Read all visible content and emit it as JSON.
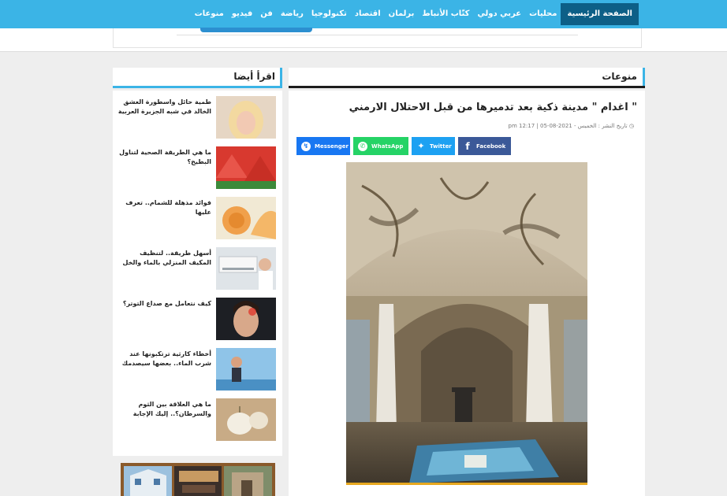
{
  "nav": {
    "items": [
      {
        "label": "الصفحة الرئيسية",
        "active": true
      },
      {
        "label": "محليات",
        "active": false
      },
      {
        "label": "عربي دولي",
        "active": false
      },
      {
        "label": "كتّاب الأنباط",
        "active": false
      },
      {
        "label": "برلمان",
        "active": false
      },
      {
        "label": "اقتصاد",
        "active": false
      },
      {
        "label": "تكنولوجيا",
        "active": false
      },
      {
        "label": "رياضة",
        "active": false
      },
      {
        "label": "فن",
        "active": false
      },
      {
        "label": "فيديو",
        "active": false
      },
      {
        "label": "منوعات",
        "active": false
      }
    ]
  },
  "main": {
    "section_title": "منوعات",
    "article_title": "\" اغدام \" مدينة ذكية بعد تدميرها من قبل الاحتلال الارمني",
    "meta": "تاريخ النشر : الخميس - 2021-08-05 | 12:17 pm",
    "share": {
      "messenger": "Messenger",
      "whatsapp": "WhatsApp",
      "twitter": "Twitter",
      "facebook": "Facebook"
    }
  },
  "sidebar": {
    "title": "اقرأ أيضا",
    "items": [
      {
        "text": "طمية حائل واسطورة العشق الخالد في شبه الجزيرة العربية"
      },
      {
        "text": "ما هي الطريقة الصحية لتناول البطيخ؟"
      },
      {
        "text": "فوائد مذهلة للشمام.. تعرف عليها"
      },
      {
        "text": "أسهل طريقة.. لتنظيف المكيف المنزلي بالماء والخل"
      },
      {
        "text": "كيف نتعامل مع صداع التوتر؟"
      },
      {
        "text": "أخطاء كارثية ترتكبونها عند شرب الماء.. بعضها سيصدمك"
      },
      {
        "text": "ما هي العلاقة بين الثوم والسرطان؟.. إليك الإجابة"
      }
    ]
  },
  "colors": {
    "nav_bg": "#3bb4e6",
    "nav_active": "#0d5f87",
    "messenger": "#1877f2",
    "whatsapp": "#25d366",
    "twitter": "#1da1f2",
    "facebook": "#3b5998"
  }
}
